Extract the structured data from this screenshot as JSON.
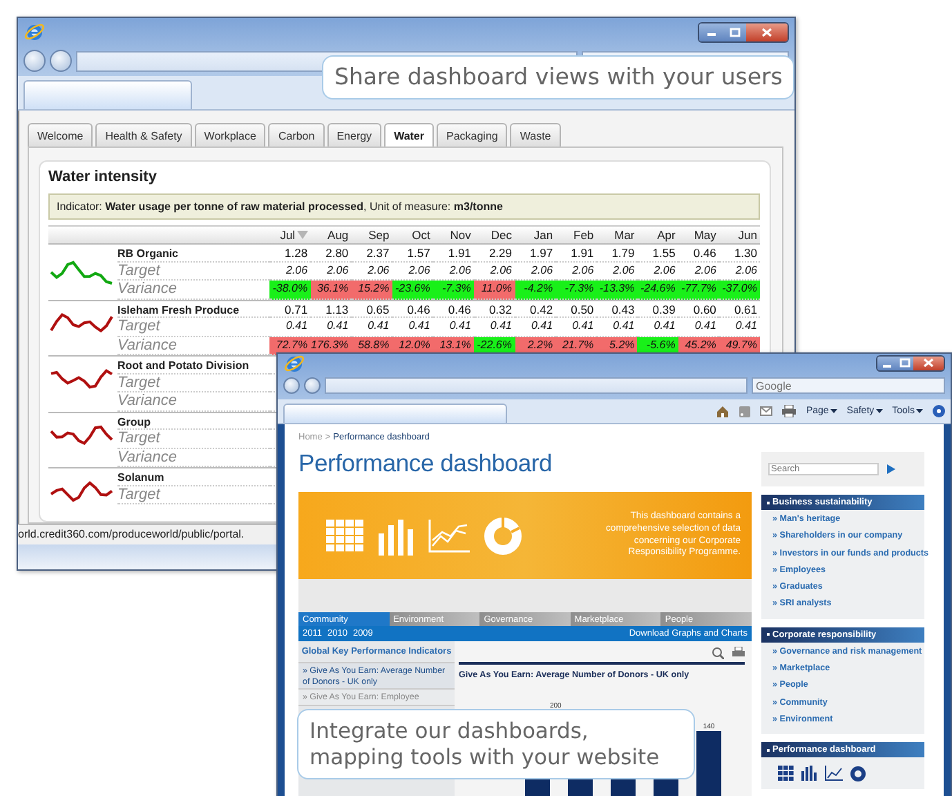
{
  "dashboard_window": {
    "status_url": "orld.credit360.com/produceworld/public/portal.",
    "tabs": [
      {
        "label": "Welcome",
        "selected": false
      },
      {
        "label": "Health & Safety",
        "selected": false
      },
      {
        "label": "Workplace",
        "selected": false
      },
      {
        "label": "Carbon",
        "selected": false
      },
      {
        "label": "Energy",
        "selected": false
      },
      {
        "label": "Water",
        "selected": true
      },
      {
        "label": "Packaging",
        "selected": false
      },
      {
        "label": "Waste",
        "selected": false
      }
    ],
    "title": "Water intensity",
    "indicator": "Indicator: **Water usage per tonne of raw material processed**, Unit of measure: **m3/tonne**",
    "months": [
      "Jul",
      "Aug",
      "Sep",
      "Oct",
      "Nov",
      "Dec",
      "Jan",
      "Feb",
      "Mar",
      "Apr",
      "May",
      "Jun"
    ],
    "groups": [
      {
        "name": "RB Organic",
        "color": "#12a812",
        "values": [
          "1.28",
          "2.80",
          "2.37",
          "1.57",
          "1.91",
          "2.29",
          "1.97",
          "1.91",
          "1.79",
          "1.55",
          "0.46",
          "1.30"
        ],
        "target_label": "Target",
        "targets": [
          "2.06",
          "2.06",
          "2.06",
          "2.06",
          "2.06",
          "2.06",
          "2.06",
          "2.06",
          "2.06",
          "2.06",
          "2.06",
          "2.06"
        ],
        "variance_label": "Variance",
        "variances": [
          {
            "text": "-38.0%",
            "above_target": false
          },
          {
            "text": "36.1%",
            "above_target": true
          },
          {
            "text": "15.2%",
            "above_target": true
          },
          {
            "text": "-23.6%",
            "above_target": false
          },
          {
            "text": "-7.3%",
            "above_target": false
          },
          {
            "text": "11.0%",
            "above_target": true
          },
          {
            "text": "-4.2%",
            "above_target": false
          },
          {
            "text": "-7.3%",
            "above_target": false
          },
          {
            "text": "-13.3%",
            "above_target": false
          },
          {
            "text": "-24.6%",
            "above_target": false
          },
          {
            "text": "-77.7%",
            "above_target": false
          },
          {
            "text": "-37.0%",
            "above_target": false
          }
        ]
      },
      {
        "name": "Isleham Fresh Produce",
        "color": "#b01010",
        "values": [
          "0.71",
          "1.13",
          "0.65",
          "0.46",
          "0.46",
          "0.32",
          "0.42",
          "0.50",
          "0.43",
          "0.39",
          "0.60",
          "0.61"
        ],
        "target_label": "Target",
        "targets": [
          "0.41",
          "0.41",
          "0.41",
          "0.41",
          "0.41",
          "0.41",
          "0.41",
          "0.41",
          "0.41",
          "0.41",
          "0.41",
          "0.41"
        ],
        "variance_label": "Variance",
        "variances": [
          {
            "text": "72.7%",
            "above_target": true
          },
          {
            "text": "176.3%",
            "above_target": true
          },
          {
            "text": "58.8%",
            "above_target": true
          },
          {
            "text": "12.0%",
            "above_target": true
          },
          {
            "text": "13.1%",
            "above_target": true
          },
          {
            "text": "-22.6%",
            "above_target": false
          },
          {
            "text": "2.2%",
            "above_target": true
          },
          {
            "text": "21.7%",
            "above_target": true
          },
          {
            "text": "5.2%",
            "above_target": true
          },
          {
            "text": "-5.6%",
            "above_target": false
          },
          {
            "text": "45.2%",
            "above_target": true
          },
          {
            "text": "49.7%",
            "above_target": true
          }
        ]
      },
      {
        "name": "Root and Potato Division",
        "color": "#b01010",
        "target_label": "Target",
        "variance_label": "Variance"
      },
      {
        "name": "Group",
        "color": "#b01010",
        "target_label": "Target",
        "variance_label": "Variance"
      },
      {
        "name": "Solanum",
        "color": "#b01010",
        "target_label": "Target"
      }
    ]
  },
  "top_callout": "Share dashboard views with your users",
  "portal_window": {
    "search_placeholder": "Google",
    "command_menus": [
      "Page",
      "Safety",
      "Tools"
    ],
    "breadcrumb": {
      "home": "Home",
      "separator": ">",
      "current": "Performance dashboard"
    },
    "heading": "Performance dashboard",
    "banner_text": "This dashboard contains a comprehensive selection of data concerning our Corporate Responsibility Programme.",
    "section_tabs": [
      {
        "label": "Community",
        "selected": true
      },
      {
        "label": "Environment",
        "selected": false
      },
      {
        "label": "Governance",
        "selected": false
      },
      {
        "label": "Marketplace",
        "selected": false
      },
      {
        "label": "People",
        "selected": false
      }
    ],
    "years": [
      "2011",
      "2010",
      "2009"
    ],
    "download_link": "Download Graphs and Charts",
    "kpi_heading": "Global Key Performance Indicators",
    "kpi_items": [
      {
        "label": "» Give As You Earn: Average Number of Donors - UK only",
        "selected": true
      },
      {
        "label": "» Give As You Earn: Employee",
        "selected": false
      }
    ],
    "chart_title": "Give As You Earn: Average Number of Donors - UK only",
    "chart_tick": "200",
    "bar_label": "140",
    "site_search_placeholder": "Search",
    "sidebar_sections": [
      {
        "kind": "links",
        "title": "Business sustainability",
        "items": [
          "» Man's heritage",
          "» Shareholders in our company",
          "» Investors in our funds and products",
          "» Employees",
          "» Graduates",
          "» SRI analysts"
        ]
      },
      {
        "kind": "links",
        "title": "Corporate responsibility",
        "items": [
          "» Governance and risk management",
          "» Marketplace",
          "» People",
          "» Community",
          "» Environment"
        ]
      },
      {
        "kind": "icons",
        "title": "Performance dashboard"
      }
    ]
  },
  "bottom_callout": "Integrate our dashboards, mapping tools with your website"
}
